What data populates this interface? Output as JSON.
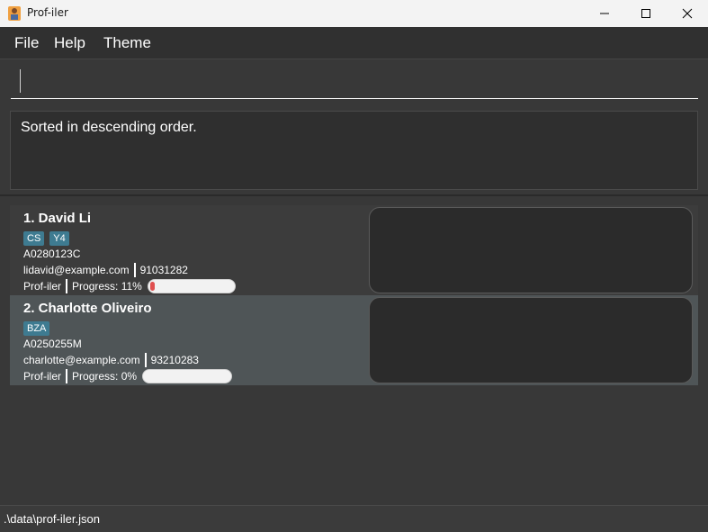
{
  "window": {
    "title": "Prof-iler",
    "minimize_icon": "minimize-icon",
    "maximize_icon": "maximize-icon",
    "close_icon": "close-icon"
  },
  "menu": {
    "file": "File",
    "help": "Help",
    "theme": "Theme"
  },
  "command": {
    "value": ""
  },
  "result": {
    "message": "Sorted in descending order."
  },
  "persons": [
    {
      "name": "1. David Li",
      "tags": [
        "CS",
        "Y4"
      ],
      "student_id": "A0280123C",
      "email": "lidavid@example.com",
      "phone": "91031282",
      "app_label": "Prof-iler",
      "progress_label": "Progress: 11%",
      "progress": 0.11
    },
    {
      "name": "2. Charlotte Oliveiro",
      "tags": [
        "BZA"
      ],
      "student_id": "A0250255M",
      "email": "charlotte@example.com",
      "phone": "93210283",
      "app_label": "Prof-iler",
      "progress_label": "Progress: 0%",
      "progress": 0.0
    }
  ],
  "status": {
    "file_path": ".\\data\\prof-iler.json"
  },
  "colors": {
    "tag": "#3e7b91",
    "progress_fill": "#e05050",
    "selected_card": "#4f5557"
  }
}
